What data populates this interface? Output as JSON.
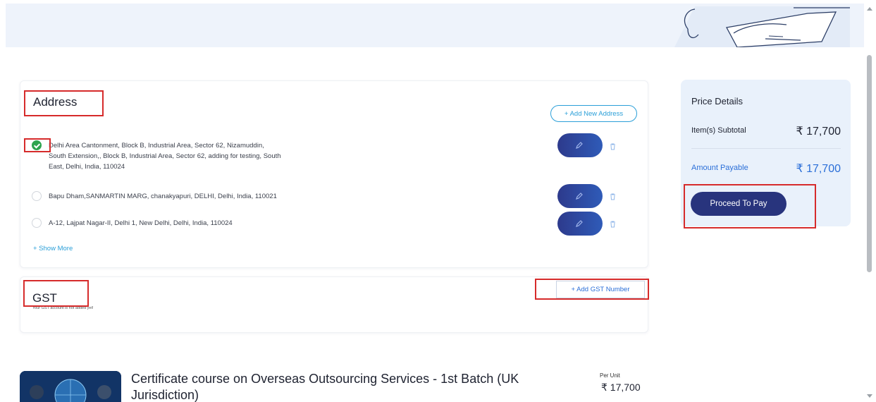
{
  "address": {
    "title": "Address",
    "add_new_label": "+ Add New Address",
    "items": [
      {
        "text_line1": "Delhi Area Cantonment, Block B, Industrial Area, Sector 62, Nizamuddin,",
        "text_line2": "South Extension,, Block B, Industrial Area, Sector 62, adding for testing, South",
        "text_line3": "East, Delhi, India, 110024",
        "selected": true
      },
      {
        "text_line1": "Bapu Dham,SANMARTIN MARG, chanakyapuri, DELHI, Delhi, India, 110021",
        "selected": false
      },
      {
        "text_line1": "A-12, Lajpat Nagar-II, Delhi 1, New Delhi, Delhi, India, 110024",
        "selected": false
      }
    ],
    "show_more_label": "+ Show More"
  },
  "gst": {
    "title": "GST",
    "note": "Your GST account is not added yet!",
    "add_label": "+ Add GST Number"
  },
  "price_details": {
    "title": "Price Details",
    "subtotal_label": "Item(s) Subtotal",
    "subtotal_value": "₹ 17,700",
    "payable_label": "Amount Payable",
    "payable_value": "₹ 17,700",
    "proceed_label": "Proceed To Pay"
  },
  "course": {
    "title": "Certificate course on Overseas Outsourcing Services - 1st Batch (UK Jurisdiction)",
    "per_unit_label": "Per Unit",
    "unit_price": "₹ 17,700"
  },
  "colors": {
    "accent_blue": "#2b9fd8",
    "button_navy": "#28347d",
    "highlight_red": "#d62b2b",
    "check_green": "#2ea44f",
    "panel_bg": "#e9f1fb"
  },
  "icons": [
    "check-icon",
    "edit-pencil-icon",
    "trash-icon",
    "illustration"
  ]
}
